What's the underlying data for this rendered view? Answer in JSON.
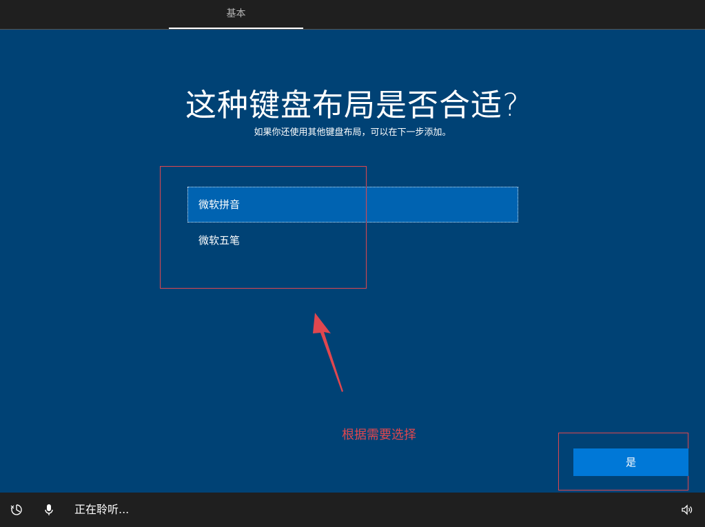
{
  "header": {
    "tab_label": "基本"
  },
  "main": {
    "title": "这种键盘布局是否合适?",
    "subtitle": "如果你还使用其他键盘布局，可以在下一步添加。",
    "options": [
      {
        "label": "微软拼音",
        "selected": true
      },
      {
        "label": "微软五笔",
        "selected": false
      }
    ],
    "yes_label": "是"
  },
  "annotation": {
    "text": "根据需要选择",
    "color": "#e0474f"
  },
  "footer": {
    "listening_text": "正在聆听...",
    "icons": [
      "accessibility-icon",
      "microphone-icon",
      "volume-icon"
    ]
  },
  "colors": {
    "background": "#004275",
    "selected_option": "#0063b1",
    "button": "#0078d7",
    "bars": "#1f1f1f"
  }
}
